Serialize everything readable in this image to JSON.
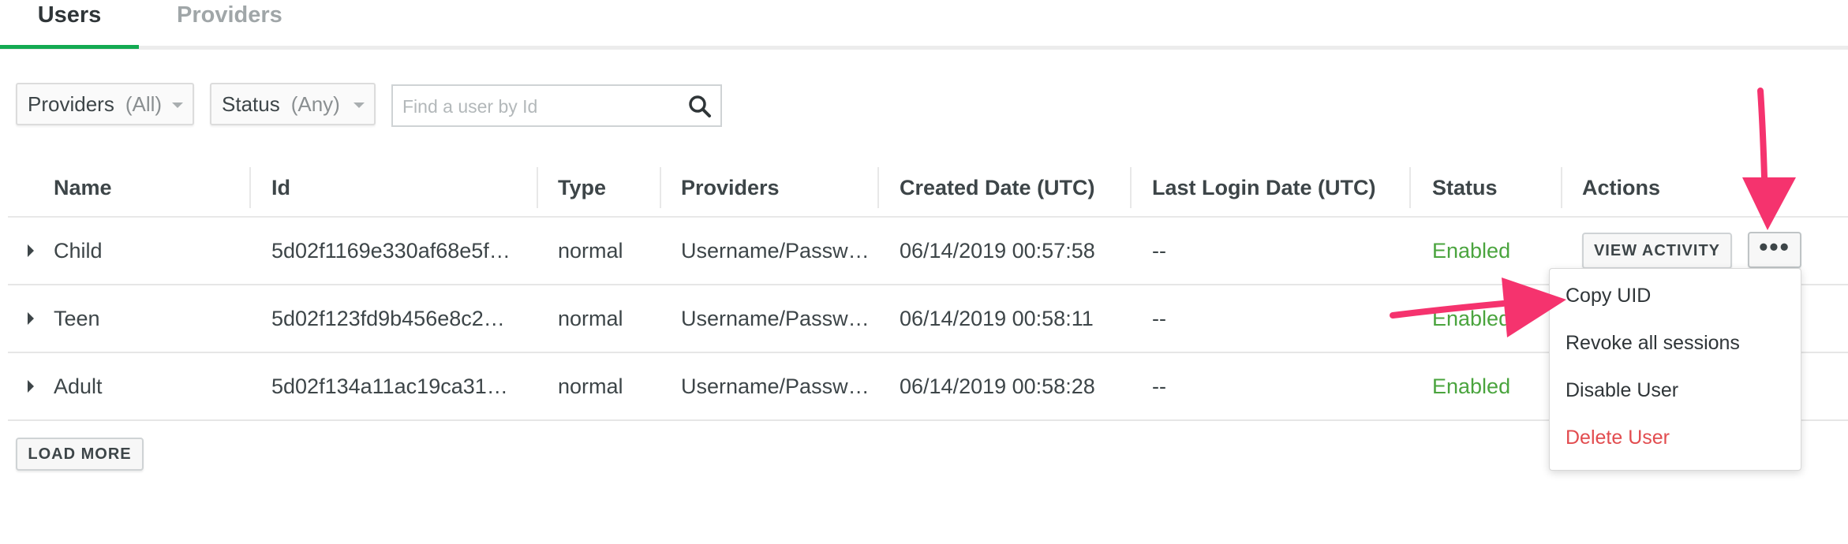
{
  "tabs": [
    {
      "label": "Users",
      "active": true
    },
    {
      "label": "Providers",
      "active": false
    }
  ],
  "filters": {
    "providers": {
      "label": "Providers",
      "value": "(All)"
    },
    "status": {
      "label": "Status",
      "value": "(Any)"
    },
    "search": {
      "placeholder": "Find a user by Id",
      "value": ""
    }
  },
  "table": {
    "columns": [
      "Name",
      "Id",
      "Type",
      "Providers",
      "Created Date (UTC)",
      "Last Login Date (UTC)",
      "Status",
      "Actions"
    ],
    "rows": [
      {
        "name": "Child",
        "id": "5d02f1169e330af68e5f…",
        "type": "normal",
        "providers": "Username/Passw…",
        "created": "06/14/2019 00:57:58",
        "last_login": "--",
        "status": "Enabled"
      },
      {
        "name": "Teen",
        "id": "5d02f123fd9b456e8c2…",
        "type": "normal",
        "providers": "Username/Passw…",
        "created": "06/14/2019 00:58:11",
        "last_login": "--",
        "status": "Enabled"
      },
      {
        "name": "Adult",
        "id": "5d02f134a11ac19ca31…",
        "type": "normal",
        "providers": "Username/Passw…",
        "created": "06/14/2019 00:58:28",
        "last_login": "--",
        "status": "Enabled"
      }
    ]
  },
  "actions": {
    "view_activity": "VIEW ACTIVITY",
    "more": "•••",
    "load_more": "LOAD MORE"
  },
  "menu": {
    "items": [
      "Copy UID",
      "Revoke all sessions",
      "Disable User",
      "Delete User"
    ]
  },
  "colors": {
    "accent": "#13aa52",
    "enabled": "#4aa43e",
    "danger": "#e24c4f",
    "annotation_arrow": "#f5336e"
  },
  "icons": {
    "search": "search-icon",
    "expand": "caret-right-icon",
    "dropdown": "chevron-down-icon",
    "annotation": "arrow-icon"
  }
}
